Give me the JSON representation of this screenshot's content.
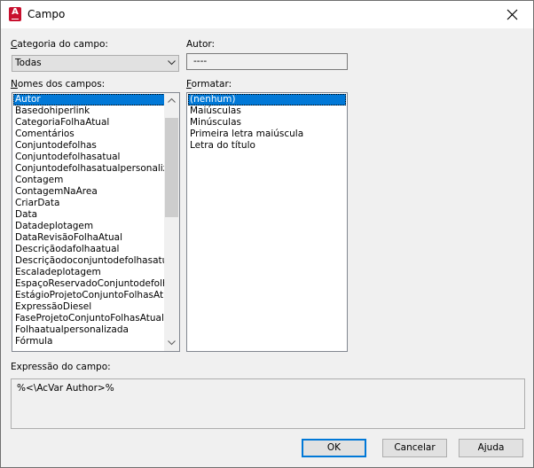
{
  "window": {
    "title": "Campo",
    "app_icon_letter": "A"
  },
  "category": {
    "label": "Categoria do campo:",
    "selected": "Todas"
  },
  "author": {
    "label": "Autor:",
    "value": "----"
  },
  "field_names": {
    "label": "Nomes dos campos:",
    "items": [
      "Autor",
      "Basedohiperlink",
      "CategoriaFolhaAtual",
      "Comentários",
      "Conjuntodefolhas",
      "Conjuntodefolhasatual",
      "Conjuntodefolhasatualpersonalizado",
      "Contagem",
      "ContagemNaÁrea",
      "CriarData",
      "Data",
      "Datadeplotagem",
      "DataRevisãoFolhaAtual",
      "Descriçãodafolhaatual",
      "Descriçãodoconjuntodefolhasatual",
      "Escaladeplotagem",
      "EspaçoReservadoConjuntodefolhas",
      "EstágioProjetoConjuntoFolhasAtual",
      "ExpressãoDiesel",
      "FaseProjetoConjuntoFolhasAtual",
      "Folhaatualpersonalizada",
      "Fórmula"
    ],
    "selected_index": 0
  },
  "format": {
    "label": "Formatar:",
    "items": [
      "(nenhum)",
      "Maiúsculas",
      "Minúsculas",
      "Primeira letra maiúscula",
      "Letra do título"
    ],
    "selected_index": 0
  },
  "expression": {
    "label": "Expressão do campo:",
    "value": "%<\\AcVar Author>%"
  },
  "buttons": {
    "ok": "OK",
    "cancel": "Cancelar",
    "help": "Ajuda"
  },
  "colors": {
    "selection": "#0078d7",
    "app_icon": "#c8102e"
  },
  "icons": {
    "app": "autocad-icon",
    "close": "close-icon",
    "dropdown": "chevron-down-icon"
  }
}
